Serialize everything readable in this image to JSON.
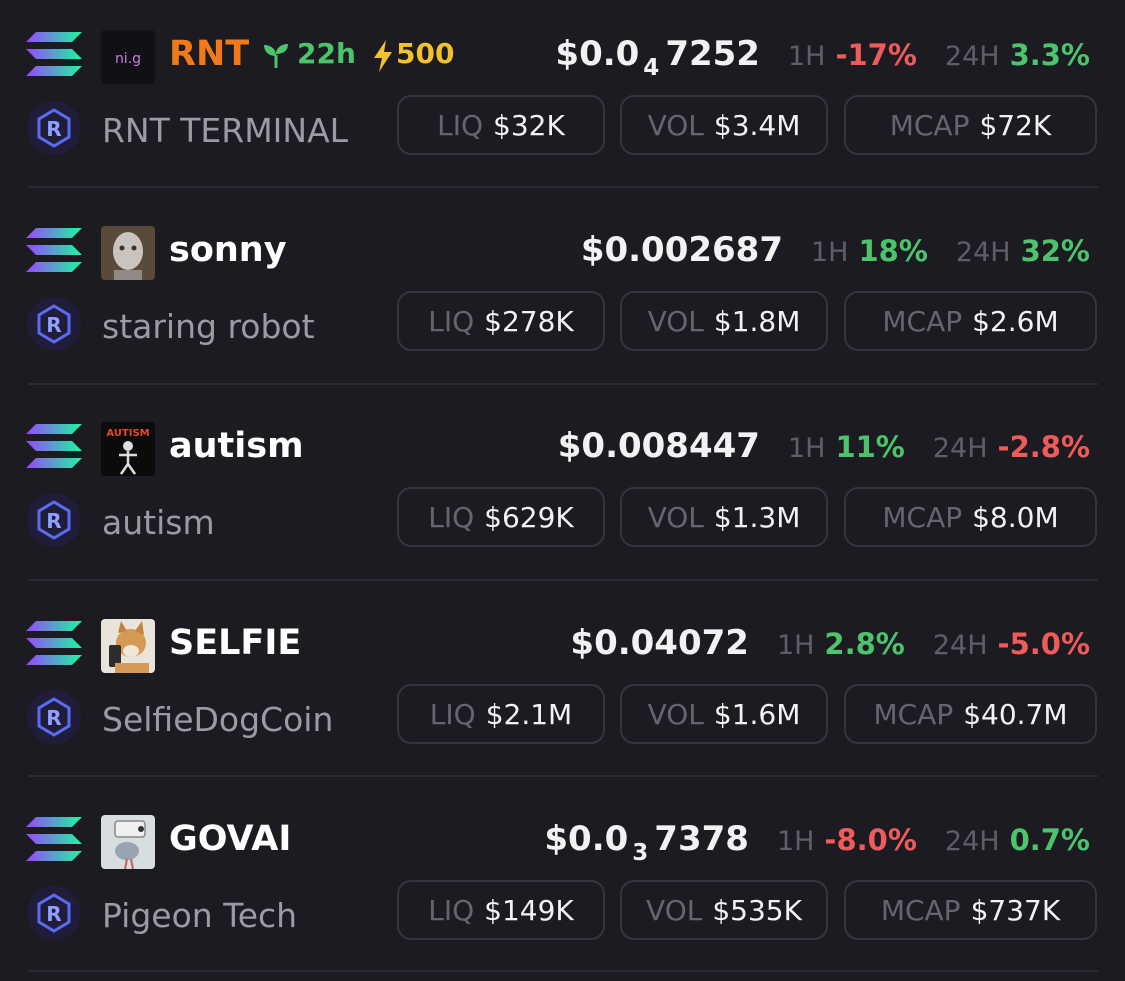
{
  "rows": [
    {
      "symbol": "RNT",
      "symbol_color": "#f07a1a",
      "logo_text": "ni.g",
      "age": "22h",
      "boost": "500",
      "price_prefix": "$0.0",
      "price_sub": "4",
      "price_rest": "7252",
      "h1_label": "1H",
      "h1": "-17%",
      "h1_dir": "down",
      "h24_label": "24H",
      "h24": "3.3%",
      "h24_dir": "up",
      "name": "RNT TERMINAL",
      "liq_label": "LIQ",
      "liq": "$32K",
      "vol_label": "VOL",
      "vol": "$3.4M",
      "mcap_label": "MCAP",
      "mcap": "$72K"
    },
    {
      "symbol": "sonny",
      "symbol_color": "#ffffff",
      "price_prefix": "$0.002687",
      "price_sub": "",
      "price_rest": "",
      "h1_label": "1H",
      "h1": "18%",
      "h1_dir": "up",
      "h24_label": "24H",
      "h24": "32%",
      "h24_dir": "up",
      "name": "staring robot",
      "liq_label": "LIQ",
      "liq": "$278K",
      "vol_label": "VOL",
      "vol": "$1.8M",
      "mcap_label": "MCAP",
      "mcap": "$2.6M"
    },
    {
      "symbol": "autism",
      "symbol_color": "#ffffff",
      "logo_text": "AUTISM",
      "price_prefix": "$0.008447",
      "price_sub": "",
      "price_rest": "",
      "h1_label": "1H",
      "h1": "11%",
      "h1_dir": "up",
      "h24_label": "24H",
      "h24": "-2.8%",
      "h24_dir": "down",
      "name": "autism",
      "liq_label": "LIQ",
      "liq": "$629K",
      "vol_label": "VOL",
      "vol": "$1.3M",
      "mcap_label": "MCAP",
      "mcap": "$8.0M"
    },
    {
      "symbol": "SELFIE",
      "symbol_color": "#ffffff",
      "price_prefix": "$0.04072",
      "price_sub": "",
      "price_rest": "",
      "h1_label": "1H",
      "h1": "2.8%",
      "h1_dir": "up",
      "h24_label": "24H",
      "h24": "-5.0%",
      "h24_dir": "down",
      "name": "SelfieDogCoin",
      "liq_label": "LIQ",
      "liq": "$2.1M",
      "vol_label": "VOL",
      "vol": "$1.6M",
      "mcap_label": "MCAP",
      "mcap": "$40.7M"
    },
    {
      "symbol": "GOVAI",
      "symbol_color": "#ffffff",
      "price_prefix": "$0.0",
      "price_sub": "3",
      "price_rest": "7378",
      "h1_label": "1H",
      "h1": "-8.0%",
      "h1_dir": "down",
      "h24_label": "24H",
      "h24": "0.7%",
      "h24_dir": "up",
      "name": "Pigeon Tech",
      "liq_label": "LIQ",
      "liq": "$149K",
      "vol_label": "VOL",
      "vol": "$535K",
      "mcap_label": "MCAP",
      "mcap": "$737K"
    }
  ],
  "icons": {
    "chain": "solana-icon",
    "dex": "raydium-icon",
    "age": "seedling-icon",
    "boost": "lightning-icon"
  },
  "colors": {
    "up": "#4cc46b",
    "down": "#ef5b5b",
    "age": "#4cc46b",
    "boost": "#f2c12e"
  }
}
